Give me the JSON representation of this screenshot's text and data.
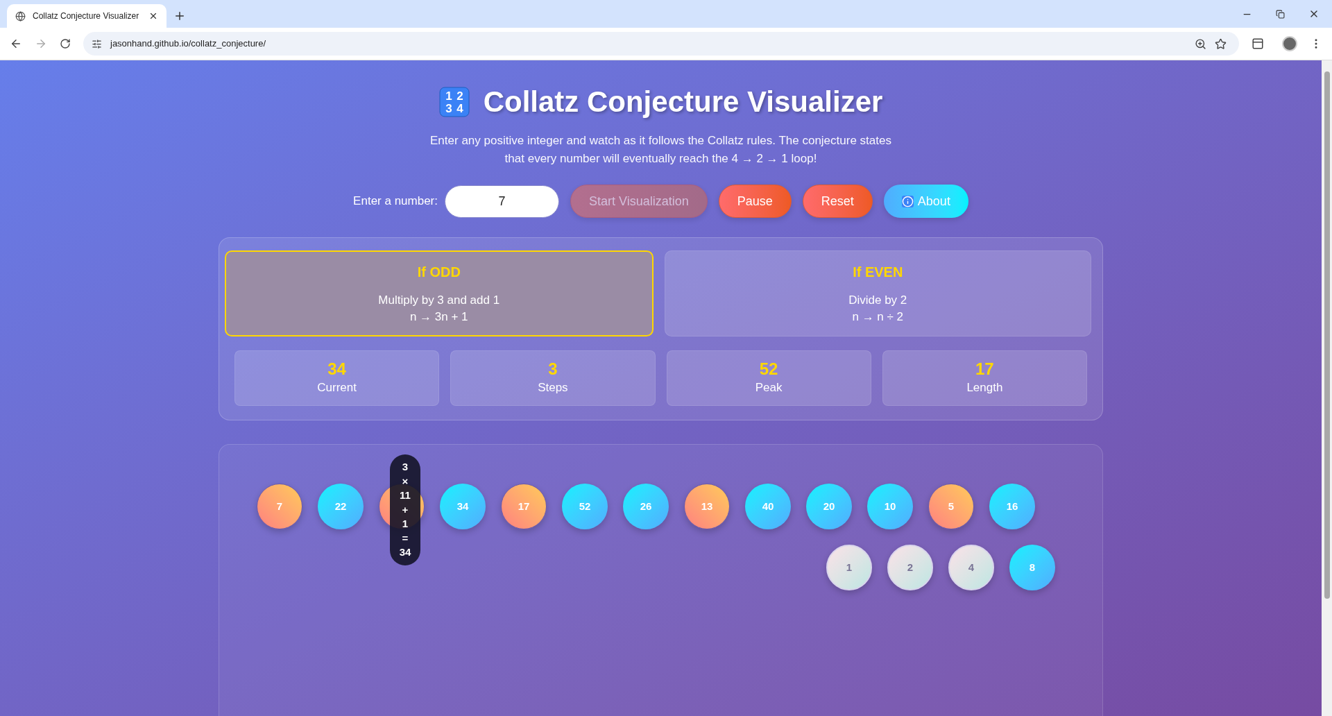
{
  "browser": {
    "tab_title": "Collatz Conjecture Visualizer",
    "url": "jasonhand.github.io/collatz_conjecture/"
  },
  "header": {
    "icon_digits": [
      "1",
      "2",
      "3",
      "4"
    ],
    "title": "Collatz Conjecture Visualizer",
    "subtitle": "Enter any positive integer and watch as it follows the Collatz rules. The conjecture states that every number will eventually reach the 4 → 2 → 1 loop!"
  },
  "controls": {
    "label": "Enter a number:",
    "value": "7",
    "buttons": [
      {
        "label": "Start Visualization",
        "kind": "start",
        "disabled": true
      },
      {
        "label": "Pause",
        "kind": "warm",
        "disabled": false
      },
      {
        "label": "Reset",
        "kind": "warm",
        "disabled": false
      },
      {
        "label": "About",
        "kind": "info",
        "disabled": false
      }
    ]
  },
  "rules": [
    {
      "title": "If ODD",
      "lines": [
        "Multiply by 3 and add 1",
        "n → 3n + 1"
      ],
      "selected": true
    },
    {
      "title": "If EVEN",
      "lines": [
        "Divide by 2",
        "n → n ÷ 2"
      ],
      "selected": false
    }
  ],
  "stats": [
    {
      "value": "34",
      "label": "Current"
    },
    {
      "value": "3",
      "label": "Steps"
    },
    {
      "value": "52",
      "label": "Peak"
    },
    {
      "value": "17",
      "label": "Length"
    }
  ],
  "sequence": {
    "rows": [
      [
        {
          "value": "7",
          "kind": "odd",
          "active": false
        },
        {
          "value": "22",
          "kind": "even",
          "active": false
        },
        {
          "kind": "odd",
          "active": true
        },
        {
          "value": "34",
          "kind": "even",
          "active": false
        },
        {
          "value": "17",
          "kind": "odd",
          "active": false
        },
        {
          "value": "52",
          "kind": "even",
          "active": false
        },
        {
          "value": "26",
          "kind": "even",
          "active": false
        },
        {
          "value": "13",
          "kind": "odd",
          "active": false
        },
        {
          "value": "40",
          "kind": "even",
          "active": false
        },
        {
          "value": "20",
          "kind": "even",
          "active": false
        },
        {
          "value": "10",
          "kind": "even",
          "active": false
        },
        {
          "value": "5",
          "kind": "odd",
          "active": false
        },
        {
          "value": "16",
          "kind": "even",
          "active": false
        }
      ],
      [
        {
          "value": "1",
          "kind": "loop",
          "active": false
        },
        {
          "value": "2",
          "kind": "loop",
          "active": false
        },
        {
          "value": "4",
          "kind": "loop",
          "active": false
        },
        {
          "value": "8",
          "kind": "even",
          "active": false
        }
      ]
    ],
    "tooltip": [
      "3",
      "×",
      "11",
      "+",
      "1",
      "=",
      "34"
    ]
  }
}
